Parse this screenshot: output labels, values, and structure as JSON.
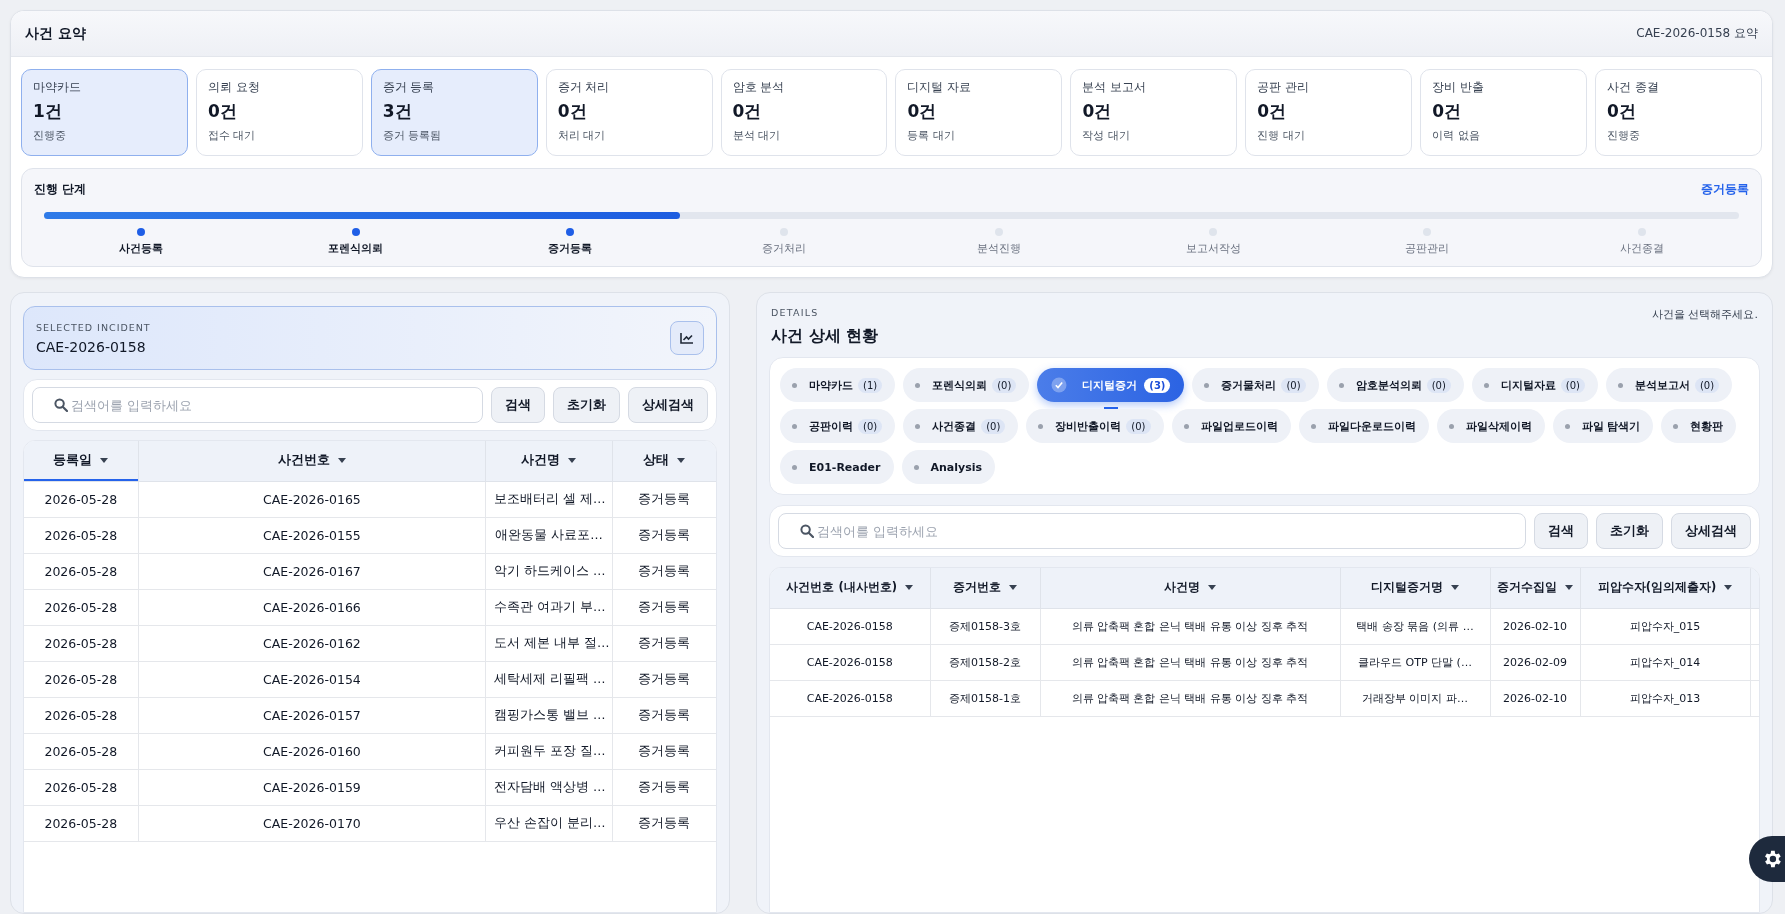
{
  "summary": {
    "title": "사건 요약",
    "case_label": "CAE-2026-0158 요약",
    "cards": [
      {
        "label": "마약카드",
        "count": "1건",
        "status": "진행중",
        "highlighted": true
      },
      {
        "label": "의뢰 요청",
        "count": "0건",
        "status": "접수 대기",
        "highlighted": false
      },
      {
        "label": "증거 등록",
        "count": "3건",
        "status": "증거 등록됨",
        "highlighted": true
      },
      {
        "label": "증거 처리",
        "count": "0건",
        "status": "처리 대기",
        "highlighted": false
      },
      {
        "label": "암호 분석",
        "count": "0건",
        "status": "분석 대기",
        "highlighted": false
      },
      {
        "label": "디지털 자료",
        "count": "0건",
        "status": "등록 대기",
        "highlighted": false
      },
      {
        "label": "분석 보고서",
        "count": "0건",
        "status": "작성 대기",
        "highlighted": false
      },
      {
        "label": "공판 관리",
        "count": "0건",
        "status": "진행 대기",
        "highlighted": false
      },
      {
        "label": "장비 반출",
        "count": "0건",
        "status": "이력 없음",
        "highlighted": false
      },
      {
        "label": "사건 종결",
        "count": "0건",
        "status": "진행중",
        "highlighted": false
      }
    ],
    "progress": {
      "title": "진행 단계",
      "current": "증거등록",
      "level": 0.375,
      "steps": [
        {
          "label": "사건등록",
          "done": true
        },
        {
          "label": "포렌식의뢰",
          "done": true
        },
        {
          "label": "증거등록",
          "done": true
        },
        {
          "label": "증거처리",
          "done": false
        },
        {
          "label": "분석진행",
          "done": false
        },
        {
          "label": "보고서작성",
          "done": false
        },
        {
          "label": "공판관리",
          "done": false
        },
        {
          "label": "사건종결",
          "done": false
        }
      ]
    }
  },
  "incident_panel": {
    "eyebrow": "SELECTED INCIDENT",
    "case_number": "CAE-2026-0158",
    "search": {
      "placeholder": "검색어를 입력하세요",
      "buttons": [
        "검색",
        "초기화",
        "상세검색"
      ]
    },
    "table": {
      "columns": [
        {
          "label": "등록일",
          "sorted": true
        },
        {
          "label": "사건번호",
          "sorted": false
        },
        {
          "label": "사건명",
          "sorted": false
        },
        {
          "label": "상태",
          "sorted": false
        }
      ],
      "rows": [
        [
          "2026-05-28",
          "CAE-2026-0165",
          "보조배터리 셀 제…",
          "증거등록"
        ],
        [
          "2026-05-28",
          "CAE-2026-0155",
          "애완동물 사료포…",
          "증거등록"
        ],
        [
          "2026-05-28",
          "CAE-2026-0167",
          "악기 하드케이스 …",
          "증거등록"
        ],
        [
          "2026-05-28",
          "CAE-2026-0166",
          "수족관 여과기 부…",
          "증거등록"
        ],
        [
          "2026-05-28",
          "CAE-2026-0162",
          "도서 제본 내부 절…",
          "증거등록"
        ],
        [
          "2026-05-28",
          "CAE-2026-0154",
          "세탁세제 리필팩 …",
          "증거등록"
        ],
        [
          "2026-05-28",
          "CAE-2026-0157",
          "캠핑가스통 밸브 …",
          "증거등록"
        ],
        [
          "2026-05-28",
          "CAE-2026-0160",
          "커피원두 포장 질…",
          "증거등록"
        ],
        [
          "2026-05-28",
          "CAE-2026-0159",
          "전자담배 액상병 …",
          "증거등록"
        ],
        [
          "2026-05-28",
          "CAE-2026-0170",
          "우산 손잡이 분리…",
          "증거등록"
        ]
      ]
    }
  },
  "details_panel": {
    "eyebrow": "DETAILS",
    "title": "사건 상세 현황",
    "hint": "사건을 선택해주세요.",
    "tabs": [
      {
        "label": "마약카드",
        "count": "(1)",
        "selected": false
      },
      {
        "label": "포렌식의뢰",
        "count": "(0)",
        "selected": false
      },
      {
        "label": "디지털증거",
        "count": "(3)",
        "selected": true
      },
      {
        "label": "증거물처리",
        "count": "(0)",
        "selected": false
      },
      {
        "label": "암호분석의뢰",
        "count": "(0)",
        "selected": false
      },
      {
        "label": "디지털자료",
        "count": "(0)",
        "selected": false
      },
      {
        "label": "분석보고서",
        "count": "(0)",
        "selected": false
      },
      {
        "label": "공판이력",
        "count": "(0)",
        "selected": false
      },
      {
        "label": "사건종결",
        "count": "(0)",
        "selected": false
      },
      {
        "label": "장비반출이력",
        "count": "(0)",
        "selected": false
      },
      {
        "label": "파일업로드이력",
        "selected": false
      },
      {
        "label": "파일다운로드이력",
        "selected": false
      },
      {
        "label": "파일삭제이력",
        "selected": false
      },
      {
        "label": "파일 탐색기",
        "selected": false
      },
      {
        "label": "현황판",
        "selected": false
      },
      {
        "label": "E01-Reader",
        "selected": false
      },
      {
        "label": "Analysis",
        "selected": false
      }
    ],
    "search": {
      "placeholder": "검색어를 입력하세요",
      "buttons": [
        "검색",
        "초기화",
        "상세검색"
      ]
    },
    "table": {
      "columns": [
        {
          "label": "사건번호 (내사번호)",
          "sorted": false
        },
        {
          "label": "증거번호",
          "sorted": false
        },
        {
          "label": "사건명",
          "sorted": false
        },
        {
          "label": "디지털증거명",
          "sorted": false
        },
        {
          "label": "증거수집일",
          "sorted": false
        },
        {
          "label": "피압수자(임의제출자)",
          "sorted": false
        }
      ],
      "rows": [
        [
          "CAE-2026-0158",
          "증제0158-3호",
          "의류 압축팩 혼합 은닉 택배 유통 이상 징후 추적",
          "택배 송장 묶음 (의류 …",
          "2026-02-10",
          "피압수자_015"
        ],
        [
          "CAE-2026-0158",
          "증제0158-2호",
          "의류 압축팩 혼합 은닉 택배 유통 이상 징후 추적",
          "클라우드 OTP 단말 (…",
          "2026-02-09",
          "피압수자_014"
        ],
        [
          "CAE-2026-0158",
          "증제0158-1호",
          "의류 압축팩 혼합 은닉 택배 유통 이상 징후 추적",
          "거래장부 이미지 파…",
          "2026-02-10",
          "피압수자_013"
        ]
      ]
    }
  }
}
